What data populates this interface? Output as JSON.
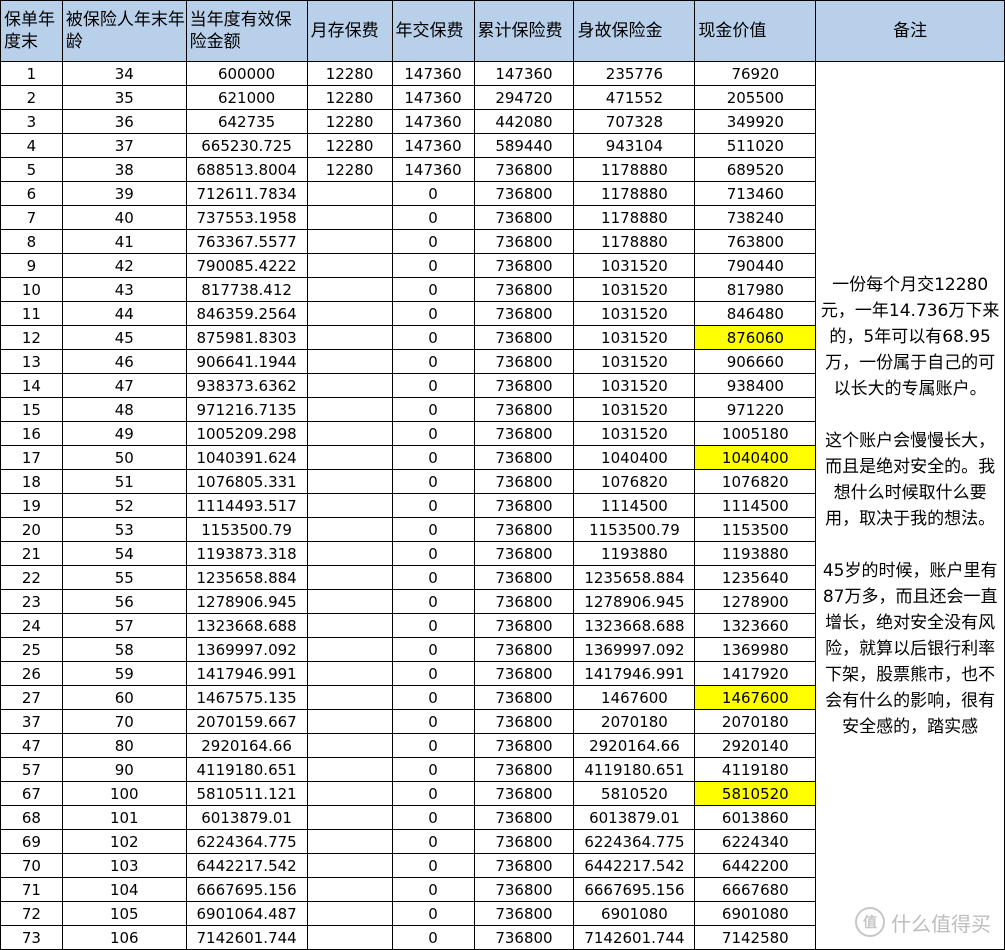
{
  "headers": [
    "保单年度末",
    "被保险人年末年龄",
    "当年度有效保险金额",
    "月存保费",
    "年交保费",
    "累计保险费",
    "身故保险金",
    "现金价值",
    "备注"
  ],
  "rows": [
    [
      "1",
      "34",
      "600000",
      "12280",
      "147360",
      "147360",
      "235776",
      "76920"
    ],
    [
      "2",
      "35",
      "621000",
      "12280",
      "147360",
      "294720",
      "471552",
      "205500"
    ],
    [
      "3",
      "36",
      "642735",
      "12280",
      "147360",
      "442080",
      "707328",
      "349920"
    ],
    [
      "4",
      "37",
      "665230.725",
      "12280",
      "147360",
      "589440",
      "943104",
      "511020"
    ],
    [
      "5",
      "38",
      "688513.8004",
      "12280",
      "147360",
      "736800",
      "1178880",
      "689520"
    ],
    [
      "6",
      "39",
      "712611.7834",
      "",
      "0",
      "736800",
      "1178880",
      "713460"
    ],
    [
      "7",
      "40",
      "737553.1958",
      "",
      "0",
      "736800",
      "1178880",
      "738240"
    ],
    [
      "8",
      "41",
      "763367.5577",
      "",
      "0",
      "736800",
      "1178880",
      "763800"
    ],
    [
      "9",
      "42",
      "790085.4222",
      "",
      "0",
      "736800",
      "1031520",
      "790440"
    ],
    [
      "10",
      "43",
      "817738.412",
      "",
      "0",
      "736800",
      "1031520",
      "817980"
    ],
    [
      "11",
      "44",
      "846359.2564",
      "",
      "0",
      "736800",
      "1031520",
      "846480"
    ],
    [
      "12",
      "45",
      "875981.8303",
      "",
      "0",
      "736800",
      "1031520",
      "876060"
    ],
    [
      "13",
      "46",
      "906641.1944",
      "",
      "0",
      "736800",
      "1031520",
      "906660"
    ],
    [
      "14",
      "47",
      "938373.6362",
      "",
      "0",
      "736800",
      "1031520",
      "938400"
    ],
    [
      "15",
      "48",
      "971216.7135",
      "",
      "0",
      "736800",
      "1031520",
      "971220"
    ],
    [
      "16",
      "49",
      "1005209.298",
      "",
      "0",
      "736800",
      "1031520",
      "1005180"
    ],
    [
      "17",
      "50",
      "1040391.624",
      "",
      "0",
      "736800",
      "1040400",
      "1040400"
    ],
    [
      "18",
      "51",
      "1076805.331",
      "",
      "0",
      "736800",
      "1076820",
      "1076820"
    ],
    [
      "19",
      "52",
      "1114493.517",
      "",
      "0",
      "736800",
      "1114500",
      "1114500"
    ],
    [
      "20",
      "53",
      "1153500.79",
      "",
      "0",
      "736800",
      "1153500.79",
      "1153500"
    ],
    [
      "21",
      "54",
      "1193873.318",
      "",
      "0",
      "736800",
      "1193880",
      "1193880"
    ],
    [
      "22",
      "55",
      "1235658.884",
      "",
      "0",
      "736800",
      "1235658.884",
      "1235640"
    ],
    [
      "23",
      "56",
      "1278906.945",
      "",
      "0",
      "736800",
      "1278906.945",
      "1278900"
    ],
    [
      "24",
      "57",
      "1323668.688",
      "",
      "0",
      "736800",
      "1323668.688",
      "1323660"
    ],
    [
      "25",
      "58",
      "1369997.092",
      "",
      "0",
      "736800",
      "1369997.092",
      "1369980"
    ],
    [
      "26",
      "59",
      "1417946.991",
      "",
      "0",
      "736800",
      "1417946.991",
      "1417920"
    ],
    [
      "27",
      "60",
      "1467575.135",
      "",
      "0",
      "736800",
      "1467600",
      "1467600"
    ],
    [
      "37",
      "70",
      "2070159.667",
      "",
      "0",
      "736800",
      "2070180",
      "2070180"
    ],
    [
      "47",
      "80",
      "2920164.66",
      "",
      "0",
      "736800",
      "2920164.66",
      "2920140"
    ],
    [
      "57",
      "90",
      "4119180.651",
      "",
      "0",
      "736800",
      "4119180.651",
      "4119180"
    ],
    [
      "67",
      "100",
      "5810511.121",
      "",
      "0",
      "736800",
      "5810520",
      "5810520"
    ],
    [
      "68",
      "101",
      "6013879.01",
      "",
      "0",
      "736800",
      "6013879.01",
      "6013860"
    ],
    [
      "69",
      "102",
      "6224364.775",
      "",
      "0",
      "736800",
      "6224364.775",
      "6224340"
    ],
    [
      "70",
      "103",
      "6442217.542",
      "",
      "0",
      "736800",
      "6442217.542",
      "6442200"
    ],
    [
      "71",
      "104",
      "6667695.156",
      "",
      "0",
      "736800",
      "6667695.156",
      "6667680"
    ],
    [
      "72",
      "105",
      "6901064.487",
      "",
      "0",
      "736800",
      "6901080",
      "6901080"
    ],
    [
      "73",
      "106",
      "7142601.744",
      "",
      "0",
      "736800",
      "7142601.744",
      "7142580"
    ]
  ],
  "highlighted_rows": [
    11,
    16,
    26,
    30
  ],
  "highlight_color": "#ffff00",
  "header_color": "#b8d0ea",
  "note_paragraphs": [
    "一份每个月交12280元，一年14.736万下来的，5年可以有68.95万，一份属于自己的可以长大的专属账户。",
    "这个账户会慢慢长大，而且是绝对安全的。我想什么时候取什么要用，取决于我的想法。",
    "45岁的时候，账户里有87万多，而且还会一直增长，绝对安全没有风险，就算以后银行利率下架，股票熊市，也不会有什么的影响，很有安全感的，踏实感"
  ],
  "watermark": {
    "badge": "值",
    "text": "什么值得买"
  }
}
